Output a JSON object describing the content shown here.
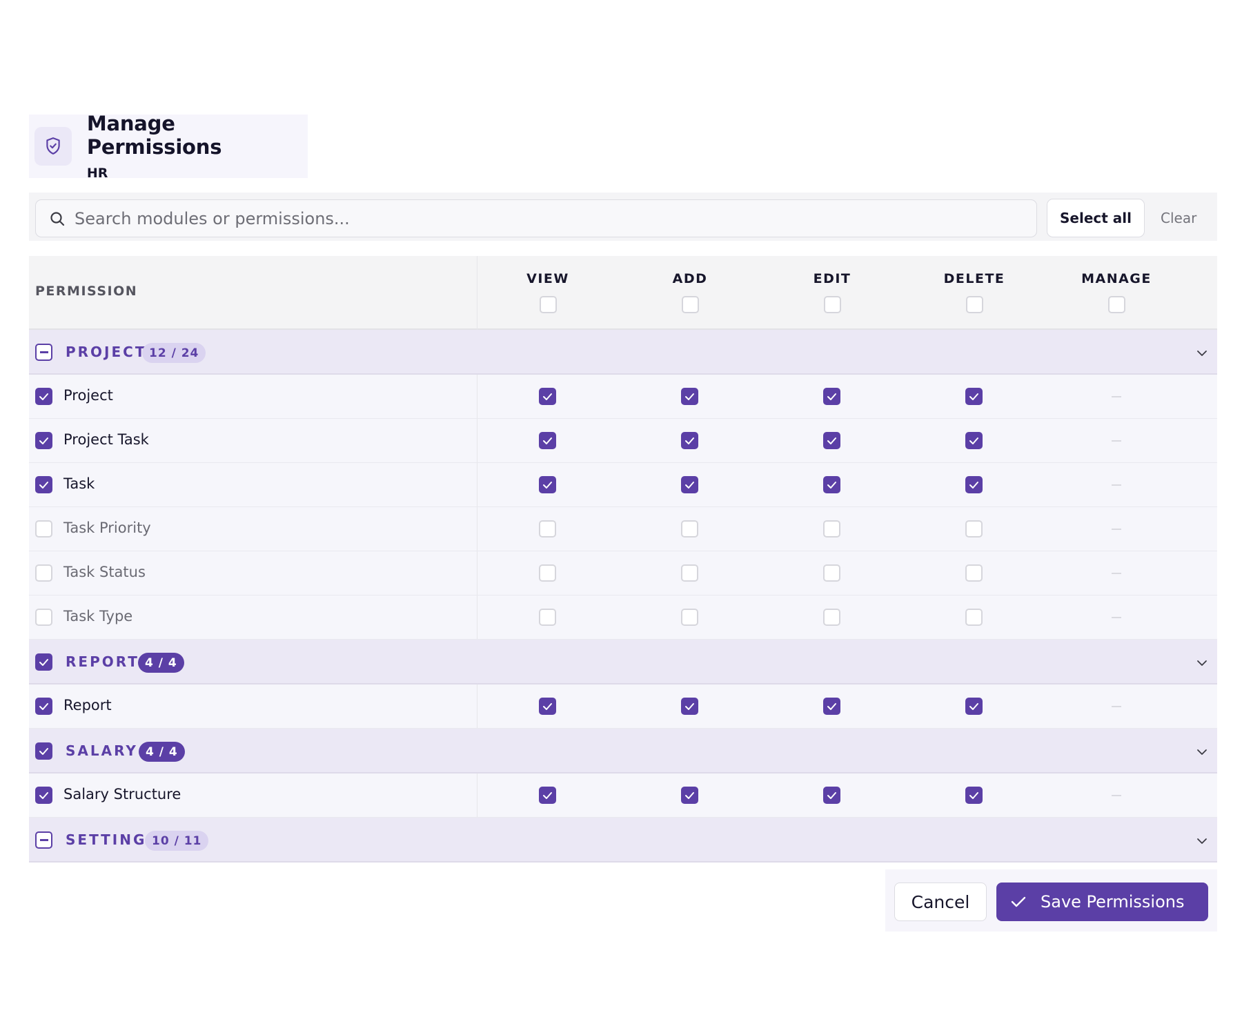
{
  "header": {
    "title": "Manage Permissions",
    "subtitle": "HR",
    "icon": "shield-check-icon"
  },
  "search": {
    "placeholder": "Search modules or permissions...",
    "value": ""
  },
  "actions": {
    "select_all": "Select all",
    "clear": "Clear"
  },
  "table": {
    "permission_header": "PERMISSION",
    "columns": [
      "VIEW",
      "ADD",
      "EDIT",
      "DELETE",
      "MANAGE"
    ],
    "groups": [
      {
        "name": "PROJECT",
        "count": "12 / 24",
        "state": "partial",
        "badge_style": "light",
        "items": [
          {
            "label": "Project",
            "checked": true,
            "perms": [
              true,
              true,
              true,
              true,
              null
            ]
          },
          {
            "label": "Project Task",
            "checked": true,
            "perms": [
              true,
              true,
              true,
              true,
              null
            ]
          },
          {
            "label": "Task",
            "checked": true,
            "perms": [
              true,
              true,
              true,
              true,
              null
            ]
          },
          {
            "label": "Task Priority",
            "checked": false,
            "perms": [
              false,
              false,
              false,
              false,
              null
            ]
          },
          {
            "label": "Task Status",
            "checked": false,
            "perms": [
              false,
              false,
              false,
              false,
              null
            ]
          },
          {
            "label": "Task Type",
            "checked": false,
            "perms": [
              false,
              false,
              false,
              false,
              null
            ]
          }
        ]
      },
      {
        "name": "REPORT",
        "count": "4 / 4",
        "state": "checked",
        "badge_style": "dark",
        "items": [
          {
            "label": "Report",
            "checked": true,
            "perms": [
              true,
              true,
              true,
              true,
              null
            ]
          }
        ]
      },
      {
        "name": "SALARY",
        "count": "4 / 4",
        "state": "checked",
        "badge_style": "dark",
        "items": [
          {
            "label": "Salary Structure",
            "checked": true,
            "perms": [
              true,
              true,
              true,
              true,
              null
            ]
          }
        ]
      },
      {
        "name": "SETTING",
        "count": "10 / 11",
        "state": "partial",
        "badge_style": "light",
        "items": []
      }
    ]
  },
  "footer": {
    "cancel": "Cancel",
    "save": "Save Permissions"
  },
  "colors": {
    "accent": "#5b3fa6",
    "group_bg": "#ebe8f5",
    "row_bg": "#f6f6fb"
  }
}
